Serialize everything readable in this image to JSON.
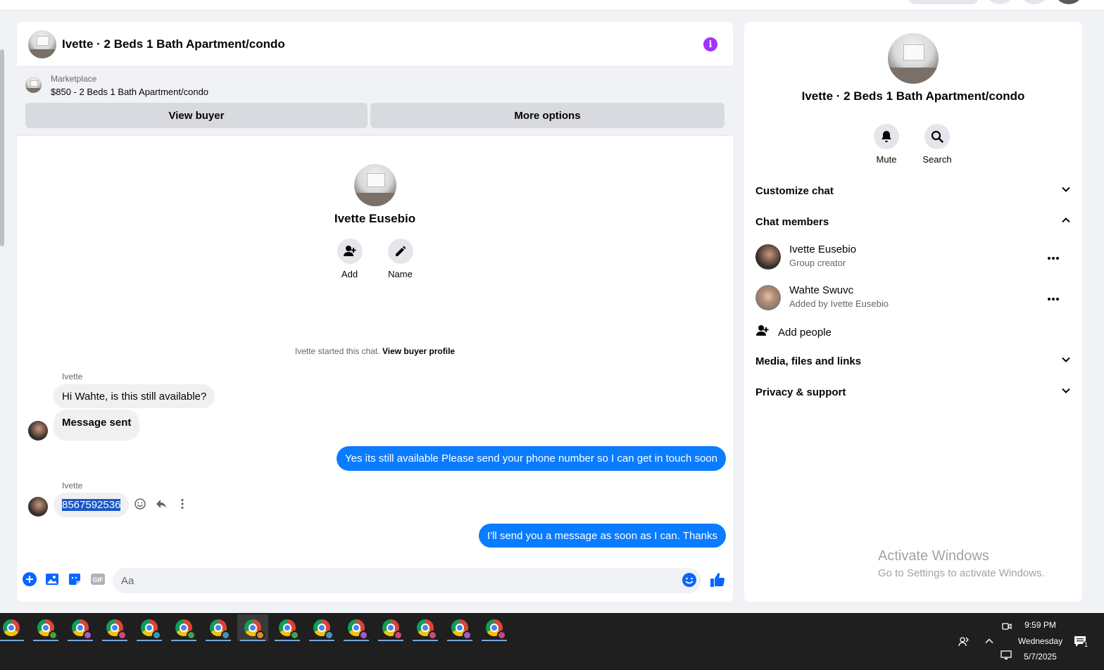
{
  "chat": {
    "title": "Ivette · 2 Beds 1 Bath Apartment/condo",
    "marketplace_label": "Marketplace",
    "marketplace_listing": "$850 - 2 Beds 1 Bath Apartment/condo",
    "view_buyer": "View buyer",
    "more_options": "More options",
    "intro_name": "Ivette Eusebio",
    "add_label": "Add",
    "name_label": "Name",
    "started_text": "Ivette started this chat.",
    "view_buyer_profile": "View buyer profile",
    "messages": [
      {
        "sender": "Ivette",
        "text": "Hi Wahte, is this still available?",
        "direction": "in"
      },
      {
        "text": "Message sent",
        "direction": "in"
      },
      {
        "text": "Yes its still available Please send your phone number so I can get in touch soon",
        "direction": "out"
      },
      {
        "sender": "Ivette",
        "text": "8567592536",
        "direction": "in"
      },
      {
        "text": "I'll send you a message as soon as I can. Thanks",
        "direction": "out"
      }
    ],
    "composer_placeholder": "Aa",
    "gif_label": "GIF"
  },
  "side": {
    "title": "Ivette · 2 Beds 1 Bath Apartment/condo",
    "mute": "Mute",
    "search": "Search",
    "customize_chat": "Customize chat",
    "chat_members": "Chat members",
    "members": [
      {
        "name": "Ivette Eusebio",
        "sub": "Group creator"
      },
      {
        "name": "Wahte Swuvc",
        "sub": "Added by Ivette Eusebio"
      }
    ],
    "add_people": "Add people",
    "media": "Media, files and links",
    "privacy": "Privacy & support",
    "activate_title": "Activate Windows",
    "activate_sub": "Go to Settings to activate Windows."
  },
  "taskbar": {
    "time": "9:59 PM",
    "day": "Wednesday",
    "date": "5/7/2025",
    "notification_count": "1",
    "chrome_badges": [
      "",
      "#3fa34d",
      "#a05cc7",
      "#d0467a",
      "#3b97b8",
      "#3fa34d",
      "#3b97b8",
      "#e08a2c",
      "#3fa34d",
      "#3b97b8",
      "#a05cc7",
      "#d0467a",
      "#d0467a",
      "#a05cc7",
      "#d0467a"
    ]
  },
  "colors": {
    "accent": "#0a7cff",
    "info": "#a033ff",
    "icon_blue": "#0866ff"
  }
}
